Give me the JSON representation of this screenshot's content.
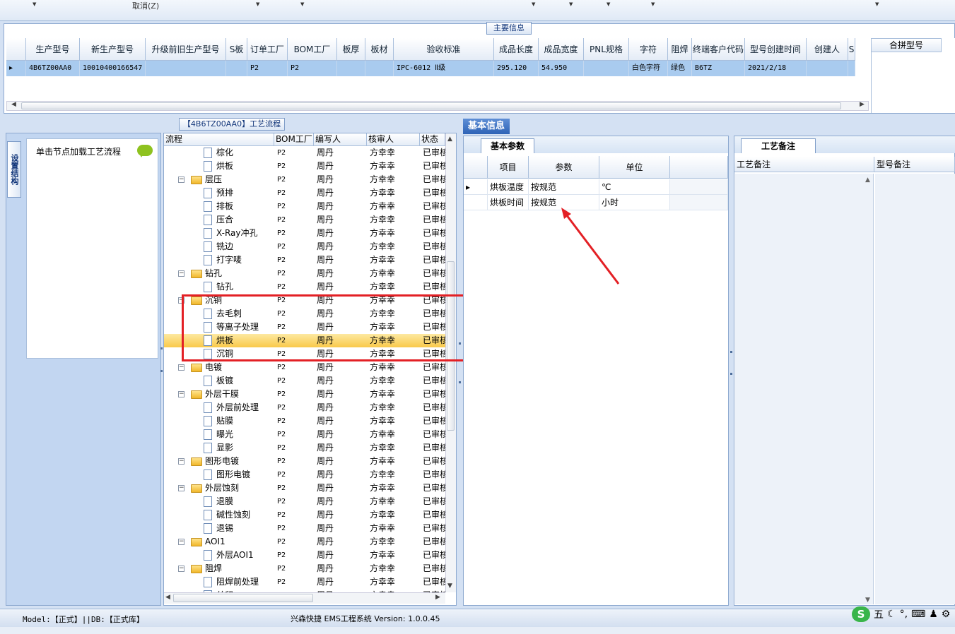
{
  "toolbar": {
    "cancel_label": "取消(Z)"
  },
  "main_info": {
    "tab_label": "主要信息",
    "columns": [
      "生产型号",
      "新生产型号",
      "升级前旧生产型号",
      "S板",
      "订单工厂",
      "BOM工厂",
      "板厚",
      "板材",
      "验收标准",
      "成品长度",
      "成品宽度",
      "PNL规格",
      "字符",
      "阻焊",
      "终端客户代码",
      "型号创建时间",
      "创建人",
      "S"
    ],
    "row": {
      "生产型号": "4B6TZ00AA0",
      "新生产型号": "10010400166547",
      "订单工厂": "P2",
      "BOM工厂": "P2",
      "验收标准": "IPC-6012 Ⅱ级",
      "成品长度": "295.120",
      "成品宽度": "54.950",
      "字符": "白色字符",
      "阻焊": "绿色",
      "终端客户代码": "B6TZ",
      "型号创建时间": "2021/2/18"
    },
    "merge_label": "合拼型号"
  },
  "side_nav": {
    "tab_label": "设置结构",
    "hint": "单击节点加载工艺流程"
  },
  "process": {
    "title": "【4B6TZ00AA0】工艺流程",
    "columns": [
      "流程",
      "BOM工厂",
      "编写人",
      "核审人",
      "状态"
    ],
    "rows": [
      {
        "name": "棕化",
        "level": 2,
        "bom": "P2",
        "editor": "周丹",
        "reviewer": "方幸幸",
        "status": "已审核"
      },
      {
        "name": "烘板",
        "level": 2,
        "bom": "P2",
        "editor": "周丹",
        "reviewer": "方幸幸",
        "status": "已审核"
      },
      {
        "name": "层压",
        "level": 1,
        "bom": "P2",
        "editor": "周丹",
        "reviewer": "方幸幸",
        "status": "已审核"
      },
      {
        "name": "预排",
        "level": 2,
        "bom": "P2",
        "editor": "周丹",
        "reviewer": "方幸幸",
        "status": "已审核"
      },
      {
        "name": "排板",
        "level": 2,
        "bom": "P2",
        "editor": "周丹",
        "reviewer": "方幸幸",
        "status": "已审核"
      },
      {
        "name": "压合",
        "level": 2,
        "bom": "P2",
        "editor": "周丹",
        "reviewer": "方幸幸",
        "status": "已审核"
      },
      {
        "name": "X-Ray冲孔",
        "level": 2,
        "bom": "P2",
        "editor": "周丹",
        "reviewer": "方幸幸",
        "status": "已审核"
      },
      {
        "name": "铣边",
        "level": 2,
        "bom": "P2",
        "editor": "周丹",
        "reviewer": "方幸幸",
        "status": "已审核"
      },
      {
        "name": "打字唛",
        "level": 2,
        "bom": "P2",
        "editor": "周丹",
        "reviewer": "方幸幸",
        "status": "已审核"
      },
      {
        "name": "钻孔",
        "level": 1,
        "bom": "P2",
        "editor": "周丹",
        "reviewer": "方幸幸",
        "status": "已审核"
      },
      {
        "name": "钻孔",
        "level": 2,
        "bom": "P2",
        "editor": "周丹",
        "reviewer": "方幸幸",
        "status": "已审核"
      },
      {
        "name": "沉铜",
        "level": 1,
        "bom": "P2",
        "editor": "周丹",
        "reviewer": "方幸幸",
        "status": "已审核"
      },
      {
        "name": "去毛刺",
        "level": 2,
        "bom": "P2",
        "editor": "周丹",
        "reviewer": "方幸幸",
        "status": "已审核"
      },
      {
        "name": "等离子处理",
        "level": 2,
        "bom": "P2",
        "editor": "周丹",
        "reviewer": "方幸幸",
        "status": "已审核"
      },
      {
        "name": "烘板",
        "level": 2,
        "bom": "P2",
        "editor": "周丹",
        "reviewer": "方幸幸",
        "status": "已审核",
        "selected": true
      },
      {
        "name": "沉铜",
        "level": 2,
        "bom": "P2",
        "editor": "周丹",
        "reviewer": "方幸幸",
        "status": "已审核"
      },
      {
        "name": "电镀",
        "level": 1,
        "bom": "P2",
        "editor": "周丹",
        "reviewer": "方幸幸",
        "status": "已审核"
      },
      {
        "name": "板镀",
        "level": 2,
        "bom": "P2",
        "editor": "周丹",
        "reviewer": "方幸幸",
        "status": "已审核"
      },
      {
        "name": "外层干膜",
        "level": 1,
        "bom": "P2",
        "editor": "周丹",
        "reviewer": "方幸幸",
        "status": "已审核"
      },
      {
        "name": "外层前处理",
        "level": 2,
        "bom": "P2",
        "editor": "周丹",
        "reviewer": "方幸幸",
        "status": "已审核"
      },
      {
        "name": "贴膜",
        "level": 2,
        "bom": "P2",
        "editor": "周丹",
        "reviewer": "方幸幸",
        "status": "已审核"
      },
      {
        "name": "曝光",
        "level": 2,
        "bom": "P2",
        "editor": "周丹",
        "reviewer": "方幸幸",
        "status": "已审核"
      },
      {
        "name": "显影",
        "level": 2,
        "bom": "P2",
        "editor": "周丹",
        "reviewer": "方幸幸",
        "status": "已审核"
      },
      {
        "name": "图形电镀",
        "level": 1,
        "bom": "P2",
        "editor": "周丹",
        "reviewer": "方幸幸",
        "status": "已审核"
      },
      {
        "name": "图形电镀",
        "level": 2,
        "bom": "P2",
        "editor": "周丹",
        "reviewer": "方幸幸",
        "status": "已审核"
      },
      {
        "name": "外层蚀刻",
        "level": 1,
        "bom": "P2",
        "editor": "周丹",
        "reviewer": "方幸幸",
        "status": "已审核"
      },
      {
        "name": "退膜",
        "level": 2,
        "bom": "P2",
        "editor": "周丹",
        "reviewer": "方幸幸",
        "status": "已审核"
      },
      {
        "name": "碱性蚀刻",
        "level": 2,
        "bom": "P2",
        "editor": "周丹",
        "reviewer": "方幸幸",
        "status": "已审核"
      },
      {
        "name": "退锡",
        "level": 2,
        "bom": "P2",
        "editor": "周丹",
        "reviewer": "方幸幸",
        "status": "已审核"
      },
      {
        "name": "AOI1",
        "level": 1,
        "bom": "P2",
        "editor": "周丹",
        "reviewer": "方幸幸",
        "status": "已审核"
      },
      {
        "name": "外层AOI1",
        "level": 2,
        "bom": "P2",
        "editor": "周丹",
        "reviewer": "方幸幸",
        "status": "已审核"
      },
      {
        "name": "阻焊",
        "level": 1,
        "bom": "P2",
        "editor": "周丹",
        "reviewer": "方幸幸",
        "status": "已审核"
      },
      {
        "name": "阻焊前处理",
        "level": 2,
        "bom": "P2",
        "editor": "周丹",
        "reviewer": "方幸幸",
        "status": "已审核"
      },
      {
        "name": "丝印",
        "level": 2,
        "bom": "P2",
        "editor": "周丹",
        "reviewer": "方幸幸",
        "status": "已审核"
      }
    ]
  },
  "basic_info": {
    "tab_label": "基本信息",
    "params_tab": "基本参数",
    "columns": [
      "项目",
      "参数",
      "单位"
    ],
    "rows": [
      {
        "item": "烘板温度",
        "param": "按规范",
        "unit": "℃"
      },
      {
        "item": "烘板时间",
        "param": "按规范",
        "unit": "小时"
      }
    ]
  },
  "notes": {
    "tab_label": "工艺备注",
    "columns": [
      "工艺备注",
      "型号备注"
    ]
  },
  "status": {
    "model": "Model:【正式】||DB:【正式库】",
    "title": "兴森快捷 EMS工程系统 Version: 1.0.0.45"
  },
  "ime": {
    "logo": "S",
    "mode": "五"
  },
  "colors": {
    "accent": "#2e63b6",
    "highlight": "#e32025",
    "selection": "#a9cbef"
  }
}
